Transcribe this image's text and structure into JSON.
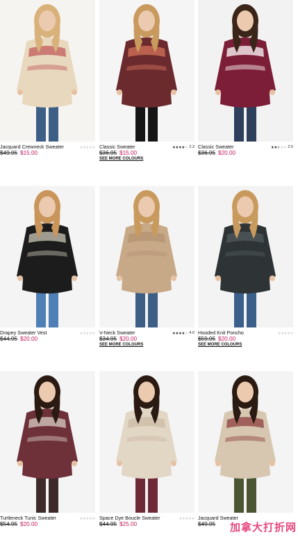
{
  "products": [
    {
      "name": "Jacquard Crewneck Sweater",
      "was": "$49.95",
      "now": "$15.00",
      "rating": 0,
      "rating_label": "",
      "more": "",
      "icon": "woman-in-beige-fairisle-sweater-photo",
      "bg": "#f6f4f1",
      "top": "#e8d8be",
      "pattern": "#c25b5b",
      "bottom": "#3d5f86",
      "hair": "#d8b27a"
    },
    {
      "name": "Classic Sweater",
      "was": "$36.95",
      "now": "$15.00",
      "rating": 4,
      "rating_label": "2.3",
      "more": "SEE MORE COLOURS",
      "icon": "woman-in-floral-sweater-photo",
      "bg": "#f5f5f5",
      "top": "#6b2b2e",
      "pattern": "#d4735a",
      "bottom": "#151515",
      "hair": "#c99a5e"
    },
    {
      "name": "Classic Sweater",
      "was": "$36.95",
      "now": "$20.00",
      "rating": 2.5,
      "rating_label": "2.5",
      "more": "",
      "icon": "woman-in-burgundy-follow-me-sweater-photo",
      "bg": "#f2f2f2",
      "top": "#7c1e37",
      "pattern": "#ffffff",
      "bottom": "#2d3f5a",
      "hair": "#3a2518"
    },
    {
      "name": "Drapey Sweater Vest",
      "was": "$44.95",
      "now": "$20.00",
      "rating": 0,
      "rating_label": "",
      "more": "",
      "icon": "woman-in-striped-vest-photo",
      "bg": "#f4f4f4",
      "top": "#1c1c1c",
      "pattern": "#cbc6b8",
      "bottom": "#4f7fb5",
      "hair": "#c9955b"
    },
    {
      "name": "V-Neck Sweater",
      "was": "$34.95",
      "now": "$20.00",
      "rating": 4,
      "rating_label": "4.0",
      "more": "SEE MORE COLOURS",
      "icon": "woman-in-oatmeal-vneck-sweater-photo",
      "bg": "#f4f4f4",
      "top": "#c7a887",
      "pattern": "#b49373",
      "bottom": "#3d5f86",
      "hair": "#c99a5e"
    },
    {
      "name": "Hooded Knit Poncho",
      "was": "$59.95",
      "now": "$20.00",
      "rating": 0,
      "rating_label": "",
      "more": "SEE MORE COLOURS",
      "icon": "woman-in-hooded-knit-poncho-photo",
      "bg": "#f3f3f3",
      "top": "#2e3436",
      "pattern": "#505a5c",
      "bottom": "#3a5f8a",
      "hair": "#c99a5e"
    },
    {
      "name": "Turtleneck Tunic Sweater",
      "was": "$54.95",
      "now": "$20.00",
      "rating": 0,
      "rating_label": "",
      "more": "",
      "icon": "woman-in-marled-turtleneck-tunic-photo",
      "bg": "#f4f4f4",
      "top": "#6e3039",
      "pattern": "#d9cfc4",
      "bottom": "#3e2a2a",
      "hair": "#2b1a12"
    },
    {
      "name": "Space Dye Boucle Sweater",
      "was": "$44.95",
      "now": "$25.00",
      "rating": 0,
      "rating_label": "",
      "more": "",
      "icon": "woman-in-cream-boucle-sweater-photo",
      "bg": "#f4f4f4",
      "top": "#e2d6c5",
      "pattern": "#cbbba5",
      "bottom": "#6d2a36",
      "hair": "#2b1a12"
    },
    {
      "name": "Jacquard Sweater",
      "was": "$49.95",
      "now": "",
      "rating": 0,
      "rating_label": "",
      "more": "",
      "icon": "woman-in-snowflake-jacquard-sweater-photo",
      "bg": "#f4f4f4",
      "top": "#d7c7b0",
      "pattern": "#8e3f3f",
      "bottom": "#4a5631",
      "hair": "#2b1a12"
    }
  ],
  "watermark": "加拿大打折网"
}
